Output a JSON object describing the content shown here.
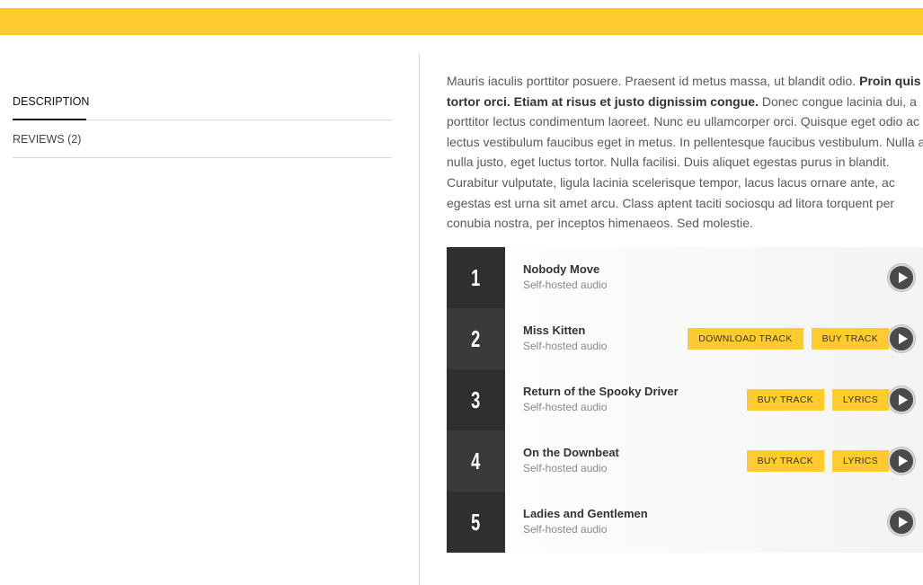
{
  "tabs": [
    {
      "label": "DESCRIPTION",
      "active": true
    },
    {
      "label": "REVIEWS (2)",
      "active": false
    }
  ],
  "description": {
    "part1": "Mauris iaculis porttitor posuere. Praesent id metus massa, ut blandit odio. ",
    "bold": "Proin quis tortor orci. Etiam at risus et justo dignissim congue.",
    "part2": " Donec congue lacinia dui, a porttitor lectus condimentum laoreet. Nunc eu ullamcorper orci. Quisque eget odio ac lectus vestibulum faucibus eget in metus. In pellentesque faucibus vestibulum. Nulla at nulla justo, eget luctus tortor. Nulla facilisi. Duis aliquet egestas purus in blandit. Curabitur vulputate, ligula lacinia scelerisque tempor, lacus lacus ornare ante, ac egestas est urna sit amet arcu. Class aptent taciti sociosqu ad litora torquent per conubia nostra, per inceptos himenaeos. Sed molestie."
  },
  "tracks": [
    {
      "number": "1",
      "title": "Nobody Move",
      "subtitle": "Self-hosted audio",
      "buttons": []
    },
    {
      "number": "2",
      "title": "Miss Kitten",
      "subtitle": "Self-hosted audio",
      "buttons": [
        "DOWNLOAD TRACK",
        "BUY TRACK"
      ]
    },
    {
      "number": "3",
      "title": "Return of the Spooky Driver",
      "subtitle": "Self-hosted audio",
      "buttons": [
        "BUY TRACK",
        "LYRICS"
      ]
    },
    {
      "number": "4",
      "title": "On the Downbeat",
      "subtitle": "Self-hosted audio",
      "buttons": [
        "BUY TRACK",
        "LYRICS"
      ]
    },
    {
      "number": "5",
      "title": "Ladies and Gentlemen",
      "subtitle": "Self-hosted audio",
      "buttons": []
    }
  ],
  "icons": {
    "play": "play-icon"
  },
  "colors": {
    "accent": "#ffcb2f",
    "number_bg": "#333333"
  }
}
